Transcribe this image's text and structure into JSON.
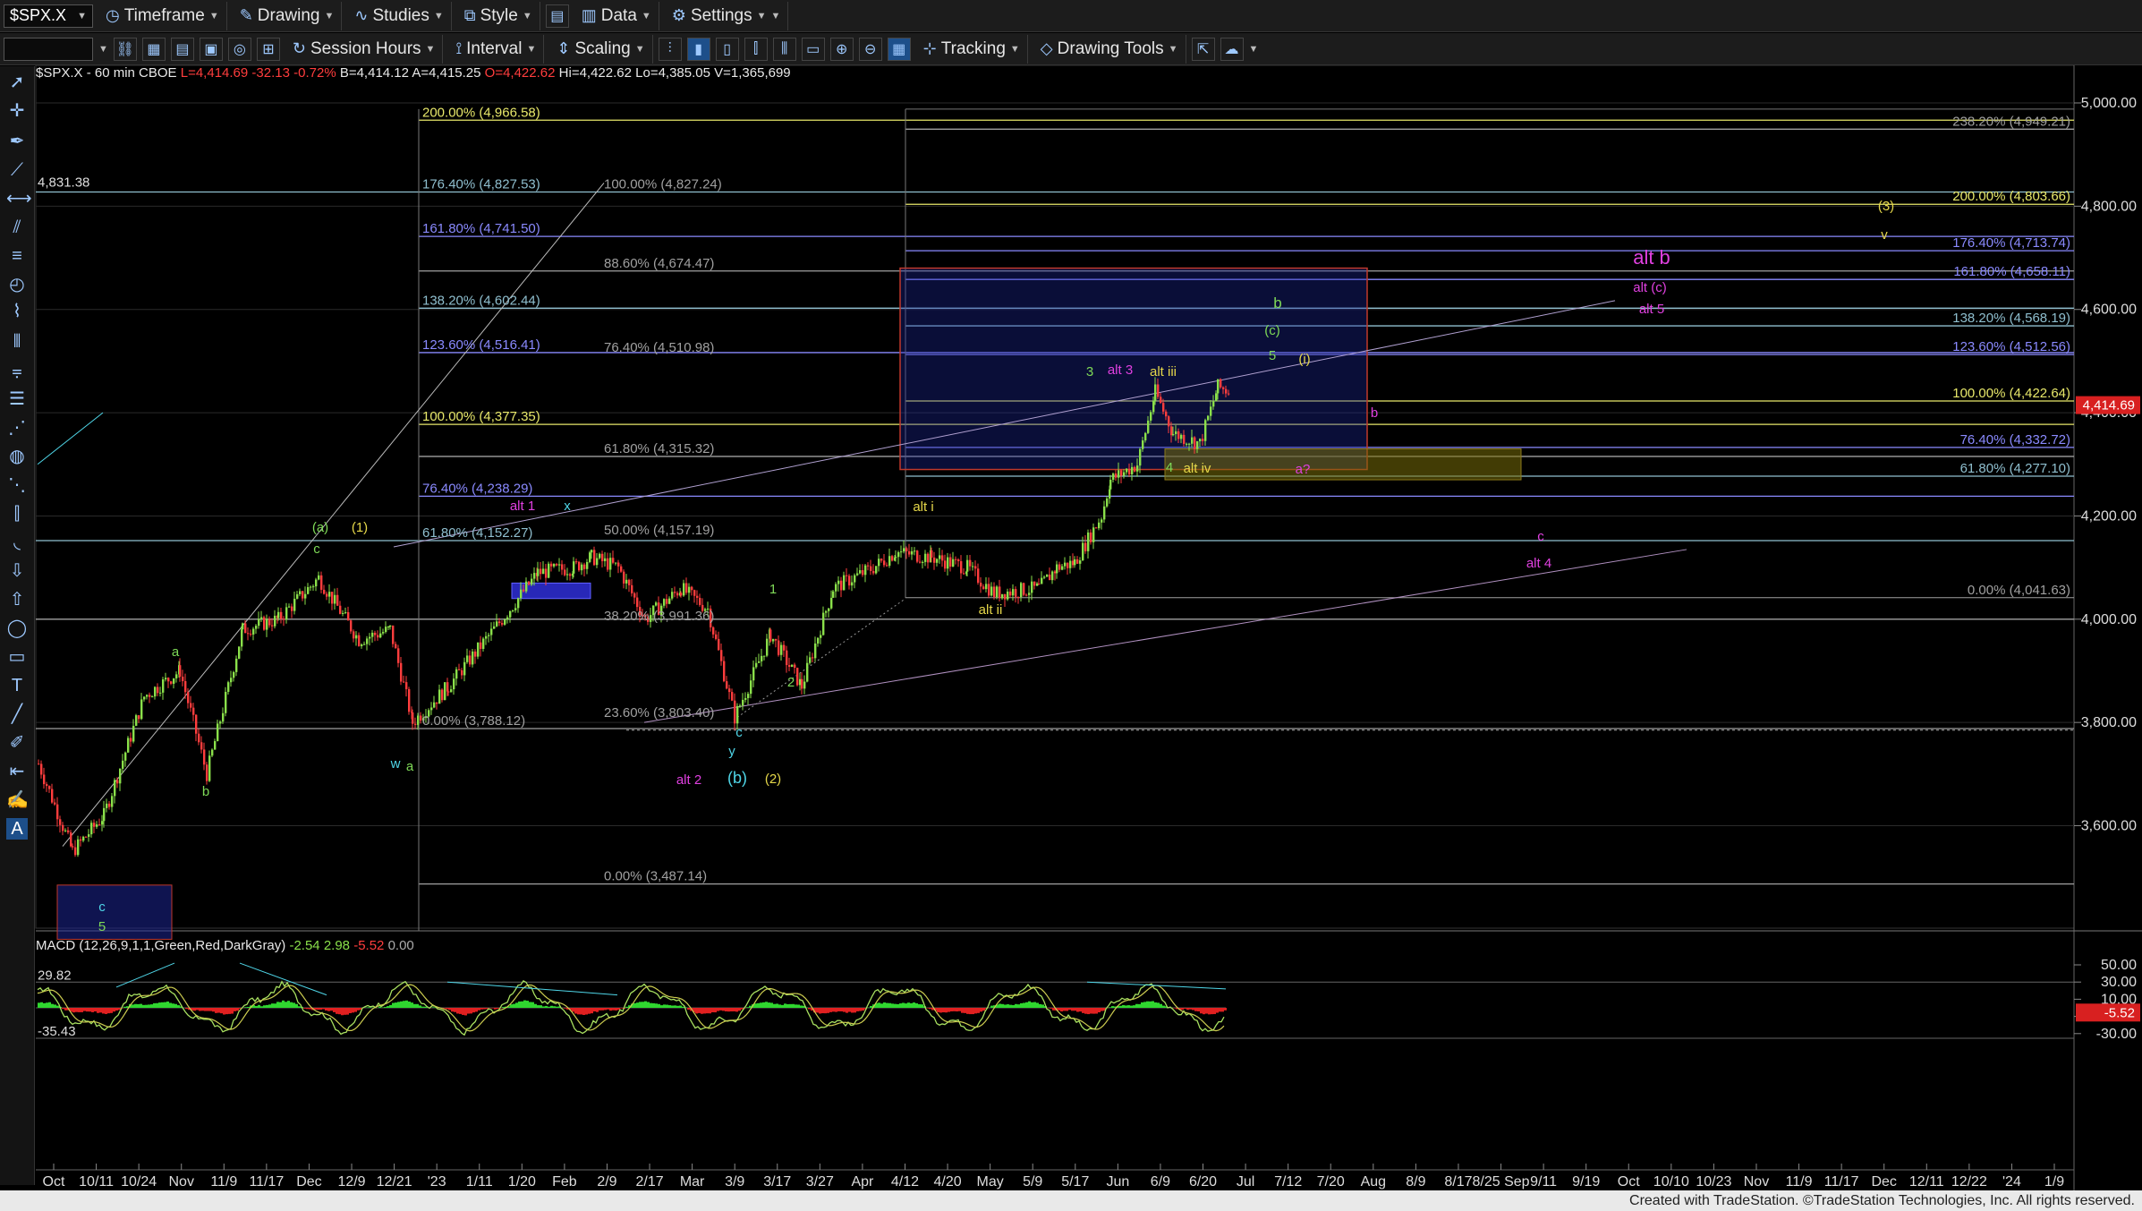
{
  "toolbar": {
    "symbol": "$SPX.X",
    "timeframe": "Timeframe",
    "drawing": "Drawing",
    "studies": "Studies",
    "style": "Style",
    "data": "Data",
    "settings": "Settings",
    "session_hours": "Session Hours",
    "interval": "Interval",
    "scaling": "Scaling",
    "tracking": "Tracking",
    "drawing_tools": "Drawing Tools"
  },
  "info": {
    "title": "$SPX.X - 60 min  CBOE",
    "last": "L=4,414.69",
    "change": "-32.13",
    "pct": "-0.72%",
    "quote": "B=4,414.12  A=4,415.25",
    "open": "O=4,422.62",
    "hilo": "Hi=4,422.62  Lo=4,385.05  V=1,365,699"
  },
  "macd": {
    "title": "MACD (12,26,9,1,1,Green,Red,DarkGray)",
    "v1": "-2.54",
    "v2": "2.98",
    "v3": "-5.52",
    "v4": "0.00"
  },
  "footer": "Created with TradeStation. ©TradeStation Technologies, Inc. All rights reserved.",
  "price_axis": [
    {
      "label": "5,000.00",
      "value": 5000
    },
    {
      "label": "4,800.00",
      "value": 4800
    },
    {
      "label": "4,600.00",
      "value": 4600
    },
    {
      "label": "4,400.00",
      "value": 4400
    },
    {
      "label": "4,200.00",
      "value": 4200
    },
    {
      "label": "4,000.00",
      "value": 4000
    },
    {
      "label": "3,800.00",
      "value": 3800
    },
    {
      "label": "3,600.00",
      "value": 3600
    }
  ],
  "macd_axis": [
    {
      "label": "50.00",
      "value": 50
    },
    {
      "label": "30.00",
      "value": 30
    },
    {
      "label": "10.00",
      "value": 10
    },
    {
      "label": "-10.00",
      "value": -10
    },
    {
      "label": "-30.00",
      "value": -30
    }
  ],
  "time_axis": [
    "Oct",
    "10/11",
    "10/24",
    "Nov",
    "11/9",
    "11/17",
    "Dec",
    "12/9",
    "12/21",
    "'23",
    "1/11",
    "1/20",
    "Feb",
    "2/9",
    "2/17",
    "Mar",
    "3/9",
    "3/17",
    "3/27",
    "Apr",
    "4/12",
    "4/20",
    "May",
    "5/9",
    "5/17",
    "Jun",
    "6/9",
    "6/20",
    "Jul",
    "7/12",
    "7/20",
    "Aug",
    "8/9",
    "8/17",
    "8/25 Sep",
    "9/11",
    "9/19",
    "Oct",
    "10/10",
    "10/23",
    "Nov",
    "11/9",
    "11/17",
    "Dec",
    "12/11",
    "12/22",
    "'24",
    "1/9"
  ],
  "right_badges": {
    "last_price": "4,414.69",
    "macd_last": "-5.52"
  },
  "left_badges": {
    "price": "4,831.38",
    "macd_hi": "29.82",
    "macd_lo": "-35.43"
  },
  "fib_labels": {
    "f200a": "200.00% (4,966.58)",
    "f176a": "176.40% (4,827.53)",
    "f100b": "100.00% (4,827.24)",
    "f161a": "161.80% (4,741.50)",
    "f886": "88.60% (4,674.47)",
    "f138a": "138.20% (4,602.44)",
    "f123a": "123.60% (4,516.41)",
    "f764b": "76.40% (4,510.98)",
    "f100a": "100.00% (4,377.35)",
    "f618b": "61.80% (4,315.32)",
    "f764a": "76.40% (4,238.29)",
    "f618a": "61.80% (4,152.27)",
    "f50b": "50.00% (4,157.19)",
    "f382b": "38.20% (3,991.36)",
    "f0a": "0.00% (3,788.12)",
    "f236b": "23.60% (3,803.40)",
    "f0b": "0.00% (3,487.14)",
    "r238": "238.20% (4,949.21)",
    "r200": "200.00% (4,803.66)",
    "r176": "176.40% (4,713.74)",
    "r161": "161.80% (4,658.11)",
    "r138": "138.20% (4,568.19)",
    "r123": "123.60% (4,512.56)",
    "r100": "100.00% (4,422.64)",
    "r764": "76.40% (4,332.72)",
    "r618": "61.80% (4,277.10)",
    "r0": "0.00% (4,041.63)"
  },
  "wave_labels": {
    "w_a_green": "a",
    "w_b_green": "b",
    "w_c_blue": "c",
    "w_5_green": "5",
    "w_a_paren": "(a)",
    "w_1_paren": "(1)",
    "w_c_green2": "c",
    "w_w": "w",
    "w_a2": "a",
    "w_x": "x",
    "w_alt1": "alt 1",
    "w_alt2": "alt 2",
    "w_1": "1",
    "w_2": "2",
    "w_c3": "c",
    "w_y": "y",
    "w_bparen": "(b)",
    "w_2paren": "(2)",
    "w_alti": "alt i",
    "w_altii": "alt ii",
    "w_3": "3",
    "w_alt3": "alt 3",
    "w_altiii": "alt iii",
    "w_4": "4",
    "w_altiv": "alt iv",
    "w_a_q": "a?",
    "w_b_mag": "b",
    "w_b_green3": "b",
    "w_c_paren": "(c)",
    "w_5b": "5",
    "w_i": "(i)",
    "w_altb": "alt b",
    "w_altc": "alt (c)",
    "w_alt5": "alt 5",
    "w_3paren": "(3)",
    "w_v": "v",
    "w_c_mag": "c",
    "w_alt4": "alt 4"
  },
  "colors": {
    "up_candle": "#8ae04a",
    "down_candle": "#ff3d3d",
    "fib_yellow": "#e8e86a",
    "fib_blue": "#8a8aff",
    "fib_gray": "#a0a0a0",
    "wave_green": "#7ed957",
    "wave_magenta": "#e040e0",
    "wave_cyan": "#4fd6e8",
    "wave_yellow": "#e6d84a"
  }
}
